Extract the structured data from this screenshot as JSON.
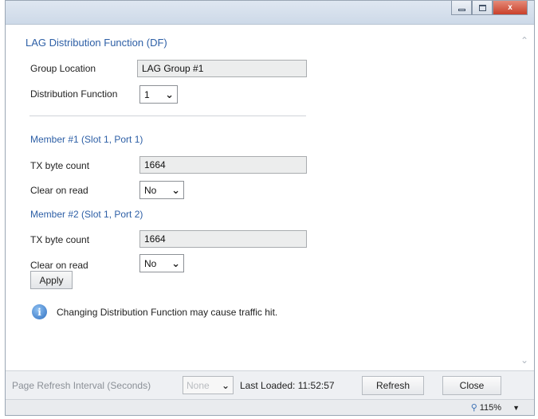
{
  "window": {
    "minimize_glyph": "",
    "maximize_glyph": "",
    "close_glyph": "x"
  },
  "lag_df": {
    "title": "LAG Distribution Function (DF)",
    "group_location_label": "Group Location",
    "group_location_value": "LAG Group #1",
    "distribution_function_label": "Distribution Function",
    "distribution_function_value": "1"
  },
  "members": [
    {
      "title": "Member #1 (Slot 1, Port 1)",
      "tx_label": "TX byte count",
      "tx_value": "1664",
      "clear_label": "Clear on read",
      "clear_value": "No"
    },
    {
      "title": "Member #2 (Slot 1, Port 2)",
      "tx_label": "TX byte count",
      "tx_value": "1664",
      "clear_label": "Clear on read",
      "clear_value": "No"
    }
  ],
  "apply_label": "Apply",
  "info_icon_glyph": "i",
  "info_message": "Changing Distribution Function may cause traffic hit.",
  "footer": {
    "refresh_interval_label": "Page Refresh Interval (Seconds)",
    "refresh_interval_value": "None",
    "last_loaded": "Last Loaded: 11:52:57",
    "refresh_label": "Refresh",
    "close_label": "Close"
  },
  "status": {
    "zoom": "115%"
  },
  "icons": {
    "info": "info-icon",
    "chevron": "chevron-down-icon",
    "zoom": "magnifier-icon"
  },
  "colors": {
    "section_title": "#2d5fa6",
    "close_button": "#c9402a",
    "field_bg": "#eceded"
  }
}
